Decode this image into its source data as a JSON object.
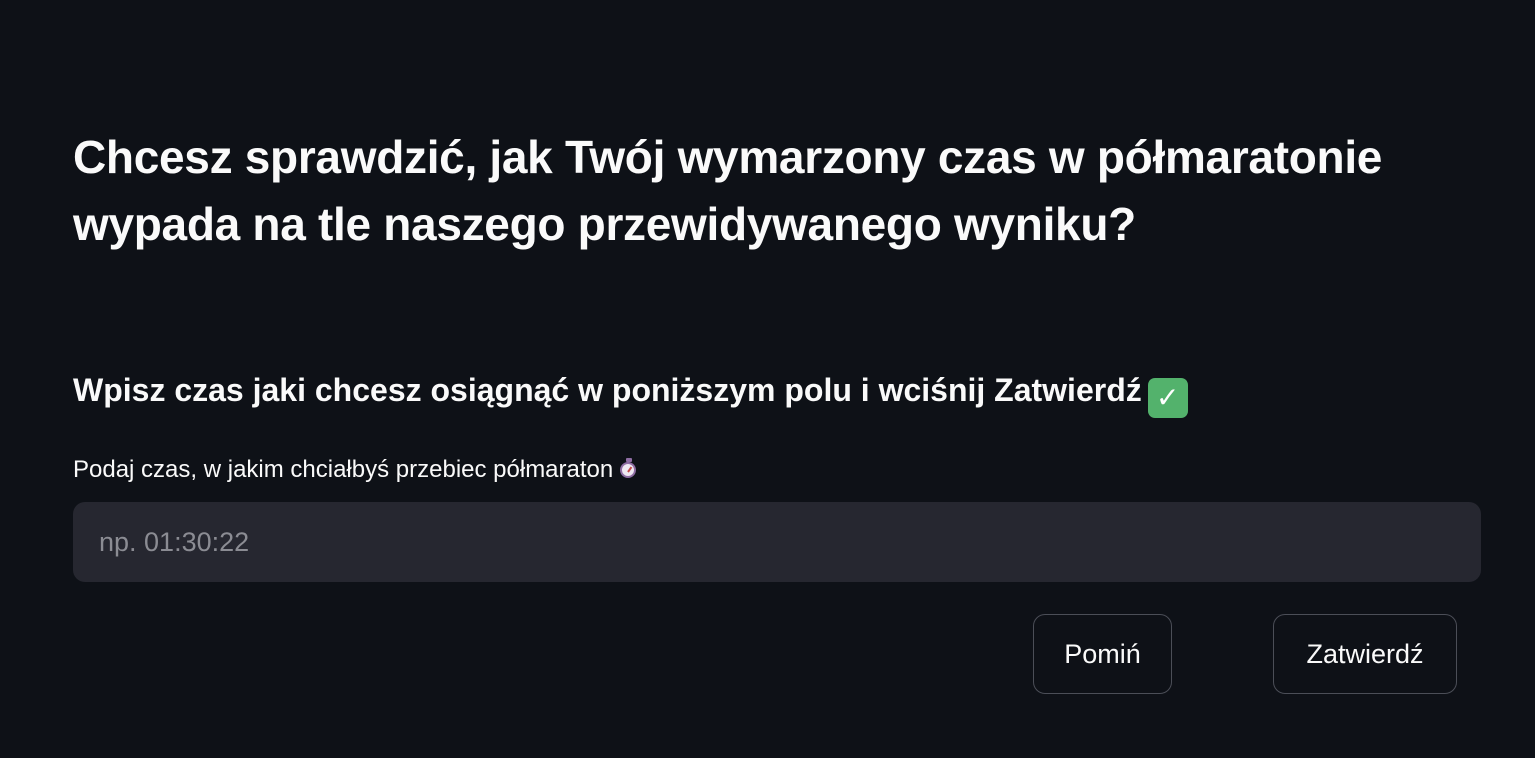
{
  "main": {
    "title": "Chcesz sprawdzić, jak Twój wymarzony czas w półmaratonie wypada na tle naszego przewidywanego wyniku?",
    "subtitle": "Wpisz czas jaki chcesz osiągnąć w poniższym polu i wciśnij Zatwierdź",
    "subtitle_icon": "white-check-mark-icon",
    "field_label": "Podaj czas, w jakim chciałbyś przebiec półmaraton",
    "field_label_icon": "stopwatch-icon",
    "time_input": {
      "value": "",
      "placeholder": "np. 01:30:22"
    },
    "buttons": {
      "skip_label": "Pomiń",
      "submit_label": "Zatwierdź"
    }
  },
  "colors": {
    "background": "#0e1117",
    "text": "#fafafa",
    "input_background": "#262730",
    "placeholder": "#8b8c93",
    "button_border": "#4b4e57",
    "check_green": "#53b26c"
  }
}
